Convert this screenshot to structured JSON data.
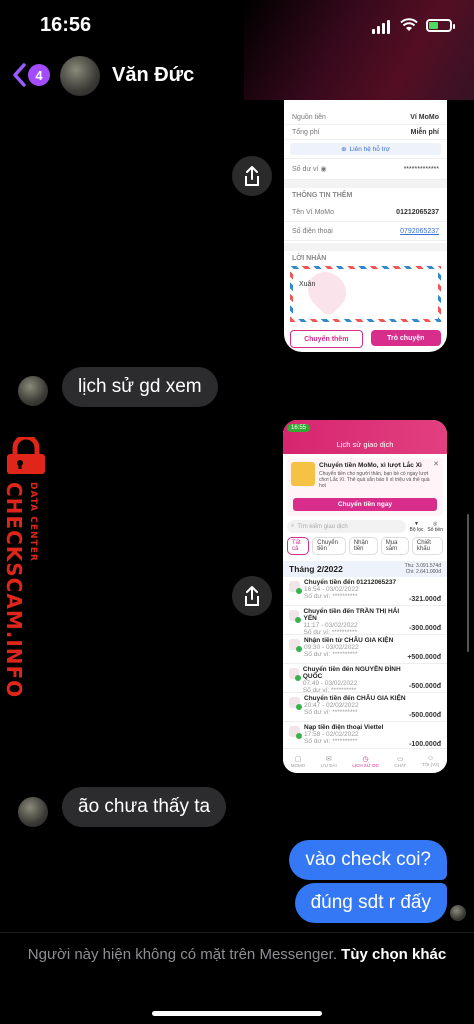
{
  "status": {
    "time": "16:56"
  },
  "header": {
    "unread_count": "4",
    "contact_name": "Văn Đức"
  },
  "receipt": {
    "rows": [
      {
        "label": "Nguồn tiền",
        "value": "Ví MoMo"
      },
      {
        "label": "Tổng phí",
        "value": "Miễn phí"
      }
    ],
    "support_link": "Liên hệ hỗ trợ",
    "balance_label": "Số dư ví",
    "balance_value": "*************",
    "section_more": "THÔNG TIN THÊM",
    "wallet_name_label": "Tên Ví MoMo",
    "wallet_name_value": "01212065237",
    "phone_label": "Số điện thoại",
    "phone_value": "0792065237",
    "message_label": "LỜI NHẮN",
    "message_value": "Xuân",
    "btn_transfer_more": "Chuyển thêm",
    "btn_chat": "Trò chuyện"
  },
  "messages": {
    "m1": "lịch sử gd xem",
    "m2": "ão chưa thấy ta",
    "m3": "vào check coi?",
    "m4": "đúng sdt r đấy"
  },
  "history": {
    "status_time": "16:55",
    "title": "Lịch sử giao dịch",
    "promo_title": "Chuyển tiền MoMo, xì lượt Lắc Xì",
    "promo_text": "Chuyển tiền cho người thân, bạn bè có ngay lượt chơi Lắc Xì. Thẻ quà sẵn báo lì xì triệu và thẻ quà hot",
    "promo_button": "Chuyển tiền ngay",
    "search_placeholder": "Tìm kiếm giao dịch",
    "filter_label": "Bộ lọc",
    "filter2_label": "Số tiền",
    "tabs": [
      "Tất cả",
      "Chuyển tiền",
      "Nhận tiền",
      "Mua sắm",
      "Chiết khấu"
    ],
    "month": "Tháng 2/2022",
    "thu_label": "Thu:",
    "thu_value": "3.091.574đ",
    "chi_label": "Chi:",
    "chi_value": "2.641.000đ",
    "transactions": [
      {
        "title": "Chuyển tiền đến 01212065237",
        "date": "16:54 - 03/02/2022",
        "balance": "Số dư ví: **********",
        "amount": "-321.000đ",
        "color": "#222"
      },
      {
        "title": "Chuyển tiền đến TRẦN THỊ HẢI YẾN",
        "date": "11:17 - 03/02/2022",
        "balance": "Số dư ví: **********",
        "amount": "-300.000đ",
        "color": "#222"
      },
      {
        "title": "Nhận tiền từ CHÂU GIA KIỆN",
        "date": "09:30 - 03/02/2022",
        "balance": "Số dư ví: **********",
        "amount": "+500.000đ",
        "color": "#222"
      },
      {
        "title": "Chuyển tiền đến NGUYỄN ĐÌNH QUỐC",
        "date": "07:49 - 03/02/2022",
        "balance": "Số dư ví: **********",
        "amount": "-500.000đ",
        "color": "#222"
      },
      {
        "title": "Chuyển tiền đến CHÂU GIA KIỆN",
        "date": "20:47 - 02/02/2022",
        "balance": "Số dư ví: **********",
        "amount": "-500.000đ",
        "color": "#222"
      },
      {
        "title": "Nạp tiền điện thoại Viettel",
        "date": "17:58 - 02/02/2022",
        "balance": "Số dư ví: **********",
        "amount": "-100.000đ",
        "color": "#222"
      }
    ],
    "bottom_nav": [
      "MOMO",
      "ƯU ĐÃI",
      "LỊCH SỬ GD",
      "CHAT",
      "TÔI (V2)"
    ]
  },
  "watermark": {
    "line1": "DATA CENTER",
    "line2": "CHECKSCAM.INFO"
  },
  "footer": {
    "note": "Người này hiện không có mặt trên Messenger.",
    "link": "Tùy chọn khác"
  },
  "colors": {
    "accent": "#9b5cff",
    "outgoing": "#3478f6",
    "momo_pink": "#d82d8b",
    "watermark": "#e0261b"
  }
}
